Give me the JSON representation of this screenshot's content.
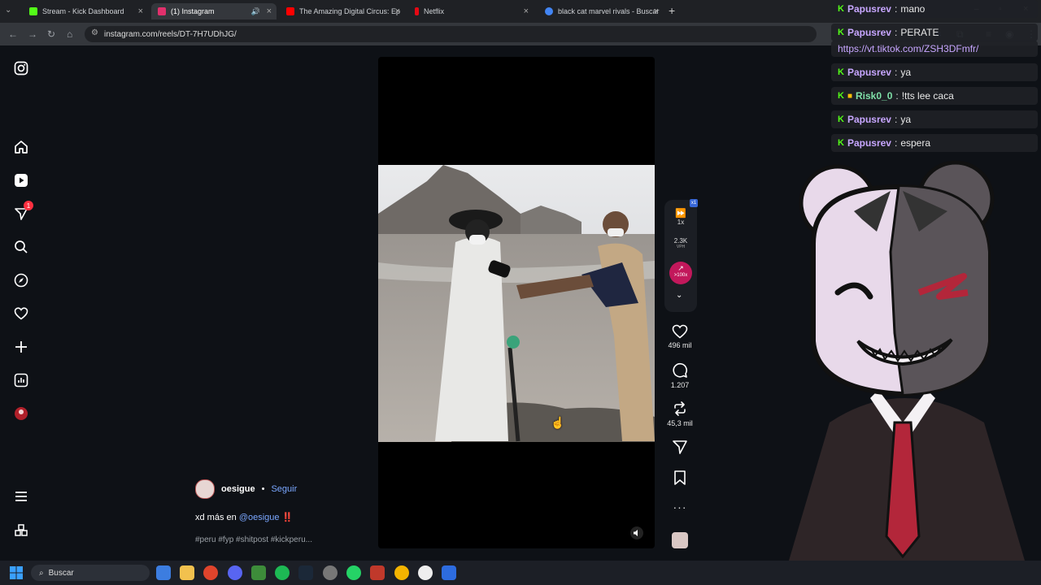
{
  "tabs": [
    {
      "title": "Stream - Kick Dashboard",
      "favicon_color": "#53fc18"
    },
    {
      "title": "(1) Instagram",
      "favicon_color": "#e1306c"
    },
    {
      "title": "The Amazing Digital Circus: Ep",
      "favicon_color": "#ff0000"
    },
    {
      "title": "Netflix",
      "favicon_color": "#e50914"
    },
    {
      "title": "black cat marvel rivals - Buscar",
      "favicon_color": "#4285f4"
    }
  ],
  "address": {
    "url": "instagram.com/reels/DT-7H7UDhJG/"
  },
  "sidebar": {
    "notification_count": "1"
  },
  "reel_tools": {
    "speed": "1x",
    "views_per_hour": "2.3K",
    "vph_label": "VPH",
    "trend": ">100x"
  },
  "actions": {
    "likes": "496 mil",
    "comments": "1.207",
    "reposts": "45,3 mil"
  },
  "post": {
    "username": "oesigue",
    "separator": "•",
    "follow_label": "Seguir",
    "caption_prefix": "xd más en",
    "caption_mention": "@oesigue",
    "caption_suffix": "‼️",
    "hashtags": "#peru #fyp #shitpost #kickperu..."
  },
  "chat": [
    {
      "user": "Papusrev",
      "message": "mano"
    },
    {
      "user": "Papusrev",
      "message": "PERATE"
    },
    {
      "user": "",
      "message": "https://vt.tiktok.com/ZSH3DFmfr/"
    },
    {
      "user": "Papusrev",
      "message": "ya"
    },
    {
      "user": "Risk0_0",
      "message": "!tts lee caca"
    },
    {
      "user": "Papusrev",
      "message": "ya"
    },
    {
      "user": "Papusrev",
      "message": "espera"
    }
  ],
  "taskbar": {
    "search_placeholder": "Buscar"
  },
  "colors": {
    "kick_green": "#53fc18",
    "instagram_link": "#7aa7ff",
    "badge_red": "#ff3040"
  }
}
